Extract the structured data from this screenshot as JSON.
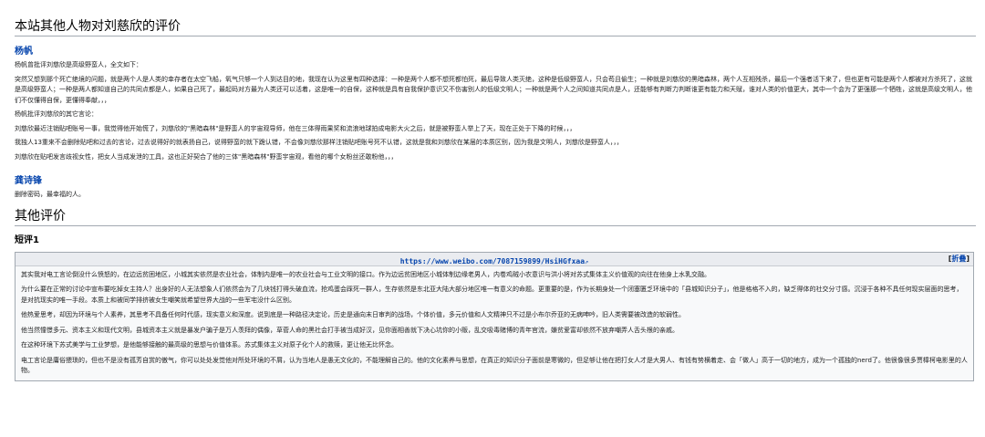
{
  "section1": {
    "title": "本站其他人物对刘慈欣的评价",
    "person1": {
      "name": "杨帆",
      "paragraphs": [
        "杨帆曾批评刘慈欣是高级野蛮人，全文如下：",
        "突然又想到那个死亡绝境的问题，就是两个人是人类的幸存者在太空飞船，氧气只够一个人到达目的地，我现在认为这里有四种选择：一种是两个人都不想死都怕死，最后导致人类灭绝，这种是低级野蛮人，只会苟且偷生；一种就是刘慈欣的黑暗森林，两个人互相残杀，最后一个强者活下来了，但也更有可能是两个人都被对方杀死了，这就是高级野蛮人；一种是两人都知道自己的共同点都是人，如果自己死了，最起码对方最为人类还可以活着，这是唯一的自保，这种就是具有自我保护意识又不伤害别人的低级文明人；一种就是两个人之间知道共同点是人，还能够有判断力判断谁更有能力和天赋，谁对人类的价值更大，其中一个会为了更强那一个牺牲，这就是高级文明人，他们不仅懂得自保，更懂得奉献，，，",
        "杨帆批评刘慈欣的其它言论：",
        "刘慈欣最近注销贴吧账号一事，我觉得他开始慌了，刘慈欣的\"黑暗森林\"是野蛮人的宇宙观导师，他在三体得雨果奖和流浪地球拍成电影大火之后，就是被野蛮人举上了天，现在正处于下降的时候，，，",
        "我独人13重来不会删除贴吧和过去的言论，过去说得好的就表扬自己，说得野蛮的就下跪认错，不会像刘慈欣那样注销贴吧账号死不认错，这就是我和刘慈欣在某届的本质区别，因为我是文明人，刘慈欣是野蛮人，，，",
        "刘慈欣在贴吧发言歧视女性，把女人当成发泄的工具，这也正好契合了他的三体\"黑暗森林\"野蛮宇宙观，看他的哪个女粉丝还敢粉他，，，"
      ]
    },
    "person2": {
      "name": "龚诗锋",
      "paragraphs": [
        "删除密码，最幸福的人。"
      ]
    }
  },
  "section2": {
    "title": "其他评价",
    "subtitle": "短评1",
    "box": {
      "link_text": "https://www.weibo.com/7087159899/HsiHGfxaa",
      "fold_open": "[",
      "fold_label": "折叠",
      "fold_close": "]",
      "paragraphs": [
        "其实我对电工言论倒没什么愤怒的，在边远贫困地区，小城其实依然是农业社会，体制内是唯一的农业社会与工业文明的接口。作为边远贫困地区小城体制边缘老男人，内卷鸡贼小农意识与洪小将对苏式集体主义价值观的向往在他身上水乳交融。",
        "为什么要在正常的讨论中宣布要吃掉女主持人？出身好的人无法想象人们依然会为了几块钱打得头破血流，抢鸡蛋会踩死一群人，生存依然是东北亚大陆大部分地区唯一有意义的命题。更重要的是，作为长期身处一个闭塞匮乏环境中的「县城知识分子」，他是格格不入的，缺乏得体的社交分寸感。沉浸于各种不具任何现实层面的思考，是对抗现实的唯一手段。本质上和被同学排挤被女生嘲笑就希望世界大战的一些军宅没什么区别。",
        "他热爱思考，却因为环境与个人素养，其思考不具备任何时代感，现实意义和深度。说到底是一种路径决定论，历史是通向末日审判的战场，个体价值，多元价值和人文精神只不过是小布尔乔亚的无病呻吟，旧人类需要被改造的软弱性。",
        "他当然憧憬多元、资本主义和现代文明，县城资本主义就是暴发户骗子是万人羡拜的偶像，草菅人命的黑社会打手被当成好汉，见你面相善就下决心坑你的小贩，乱交吸毒赌博的青年官流，嫌贫爱富却依然不放弃嘲弄人舌头根的亲戚。",
        "在这种环境下苏式美学与工业梦想，是他能够接触的最高级的思想与价值体系。苏式集体主义对原子化个人的救赎，更让他无比怀念。",
        "电工言论是庸俗猥琐的，但也不是没有孤芳自赏的傲气，你可以处处发觉他对所处环境的不屑，认为当地人是愚无文化的，不能理解自己的。他的文化素养与思想，在真正的知识分子面前是寒微的，但足够让他在把打女人才是大男人、有钱有势横着走、会「做人」高于一切的地方，成为一个孤独的nerd了。他很像很多贾樟柯电影里的人物。"
      ]
    }
  }
}
